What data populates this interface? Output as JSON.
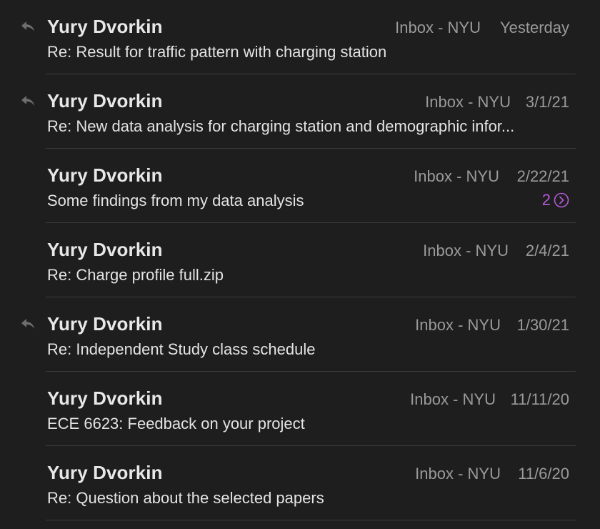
{
  "messages": [
    {
      "sender": "Yury Dvorkin",
      "mailbox": "Inbox - NYU",
      "date": "Yesterday",
      "subject": "Re: Result for traffic pattern with charging station",
      "replied": true
    },
    {
      "sender": "Yury Dvorkin",
      "mailbox": "Inbox - NYU",
      "date": "3/1/21",
      "subject": "Re: New data analysis for charging station and demographic infor...",
      "replied": true
    },
    {
      "sender": "Yury Dvorkin",
      "mailbox": "Inbox - NYU",
      "date": "2/22/21",
      "subject": "Some findings from my data analysis",
      "replied": false,
      "thread_count": "2"
    },
    {
      "sender": "Yury Dvorkin",
      "mailbox": "Inbox - NYU",
      "date": "2/4/21",
      "subject": "Re: Charge profile full.zip",
      "replied": false
    },
    {
      "sender": "Yury Dvorkin",
      "mailbox": "Inbox - NYU",
      "date": "1/30/21",
      "subject": "Re: Independent Study class schedule",
      "replied": true
    },
    {
      "sender": "Yury Dvorkin",
      "mailbox": "Inbox - NYU",
      "date": "11/11/20",
      "subject": "ECE 6623: Feedback on your project",
      "replied": false
    },
    {
      "sender": "Yury Dvorkin",
      "mailbox": "Inbox - NYU",
      "date": "11/6/20",
      "subject": "Re: Question about the selected papers",
      "replied": false
    }
  ],
  "colors": {
    "background": "#1e1e1e",
    "thread_accent": "#b45ad8"
  },
  "icons": {
    "replied": "reply-icon",
    "thread": "chevron-right-circle-icon"
  }
}
